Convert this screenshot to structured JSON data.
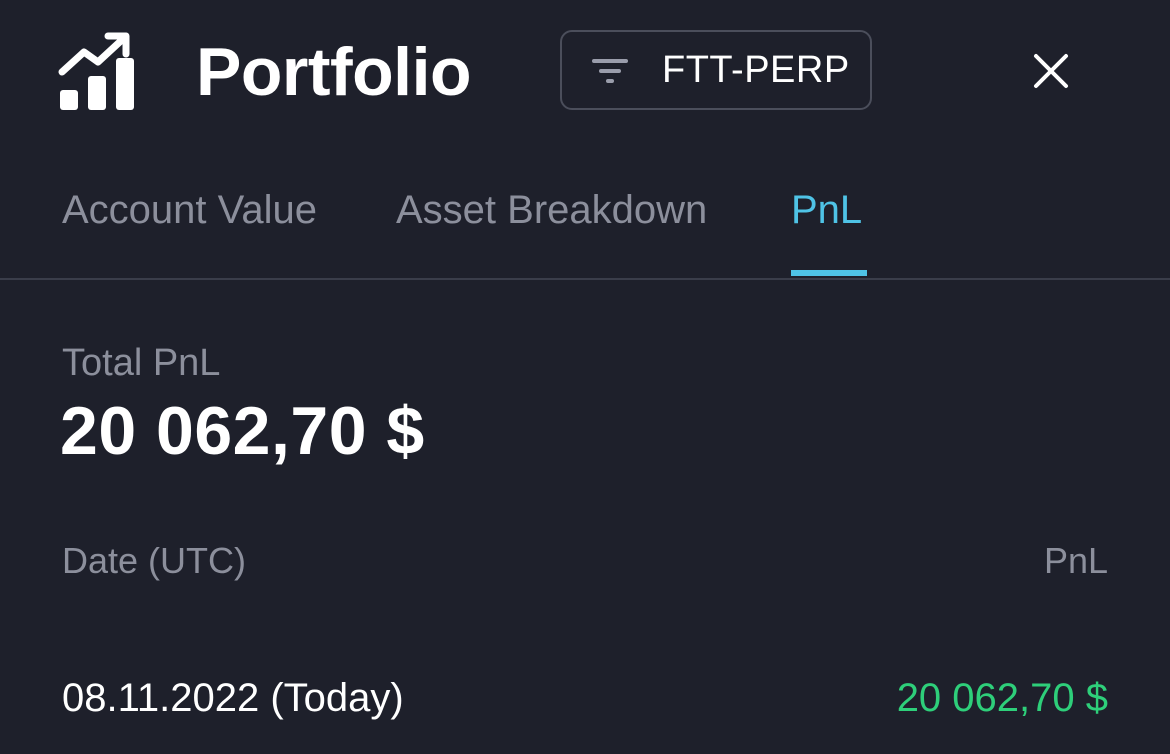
{
  "header": {
    "title": "Portfolio",
    "logo_icon": "chart-trending-up-icon",
    "filter": {
      "icon": "filter-icon",
      "label": "FTT-PERP"
    },
    "close_icon": "close-icon"
  },
  "tabs": [
    {
      "label": "Account Value",
      "active": false
    },
    {
      "label": "Asset Breakdown",
      "active": false
    },
    {
      "label": "PnL",
      "active": true
    }
  ],
  "summary": {
    "label": "Total PnL",
    "value": "20 062,70 $"
  },
  "table": {
    "headers": {
      "date": "Date (UTC)",
      "pnl": "PnL"
    },
    "rows": [
      {
        "date": "08.11.2022 (Today)",
        "pnl": "20 062,70 $"
      }
    ]
  },
  "colors": {
    "background": "#1e202b",
    "accent": "#4fc3e6",
    "positive": "#2ecf7a",
    "muted_text": "#8c8f9c"
  }
}
